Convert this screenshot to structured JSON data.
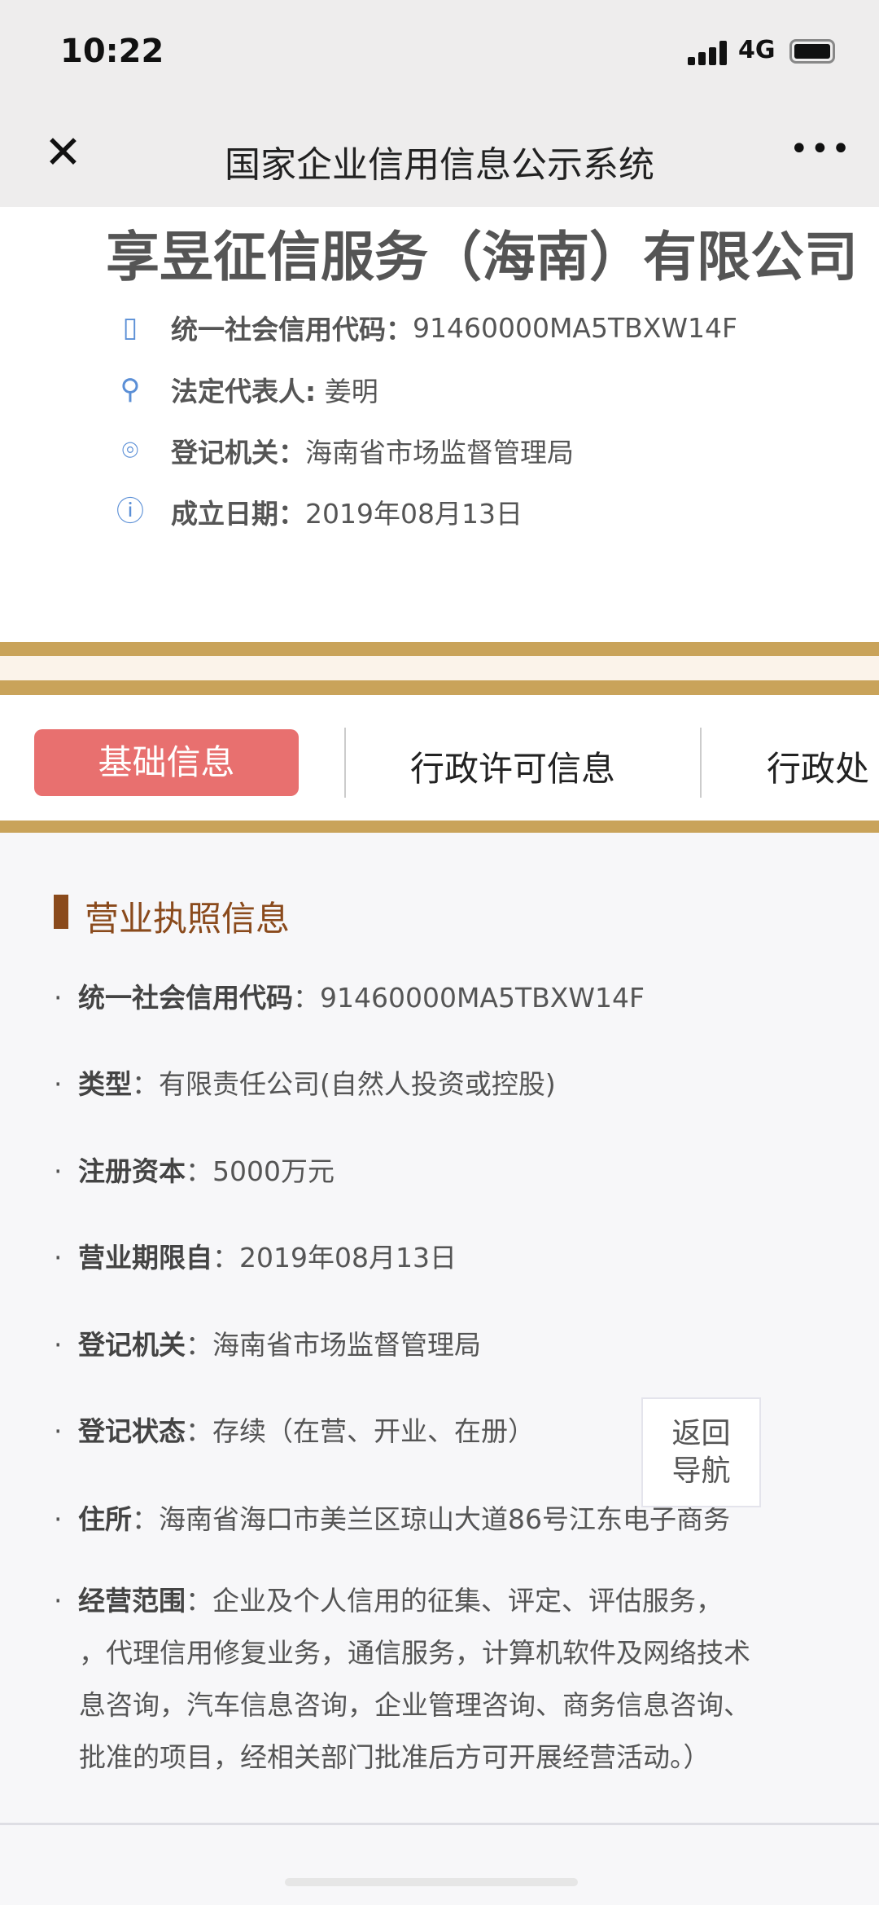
{
  "status_bar": {
    "time": "10:22",
    "network": "4G",
    "battery_level": 0.85
  },
  "nav": {
    "title": "国家企业信用信息公示系统",
    "close_icon": "close-icon",
    "more_icon": "more-icon"
  },
  "company": {
    "name": "享昱征信服务（海南）有限公司",
    "credit_code_label": "统一社会信用代码：",
    "credit_code": "91460000MA5TBXW14F",
    "legal_rep_label": "法定代表人:",
    "legal_rep": "姜明",
    "authority_label": "登记机关：",
    "authority": "海南省市场监督管理局",
    "founded_label": "成立日期：",
    "founded": "2019年08月13日"
  },
  "tabs": [
    {
      "label": "基础信息",
      "active": true
    },
    {
      "label": "行政许可信息"
    },
    {
      "label": "行政处"
    }
  ],
  "section": {
    "title": "营业执照信息"
  },
  "rows": [
    {
      "label": "统一社会信用代码",
      "value": "91460000MA5TBXW14F"
    },
    {
      "label": "类型",
      "value": "有限责任公司(自然人投资或控股)"
    },
    {
      "label": "注册资本",
      "value": "5000万元"
    },
    {
      "label": "营业期限自",
      "value": "2019年08月13日"
    },
    {
      "label": "登记机关",
      "value": "海南省市场监督管理局"
    },
    {
      "label": "登记状态",
      "value": "存续（在营、开业、在册）"
    },
    {
      "label": "住所",
      "value": "海南省海口市美兰区琼山大道86号江东电子商务"
    },
    {
      "label": "经营范围",
      "value": "企业及个人信用的征集、评定、评估服务，",
      "more": [
        "，代理信用修复业务，通信服务，计算机软件及网络技术",
        "息咨询，汽车信息咨询，企业管理咨询、商务信息咨询、",
        "批准的项目，经相关部门批准后方可开展经营活动。）"
      ]
    }
  ],
  "sep": "：",
  "float_button": {
    "line1": "返回",
    "line2": "导航"
  },
  "colors": {
    "accent": "#e8706f",
    "gold": "#c9a35a",
    "section": "#8a4a1c",
    "icon": "#5b8fd6"
  }
}
